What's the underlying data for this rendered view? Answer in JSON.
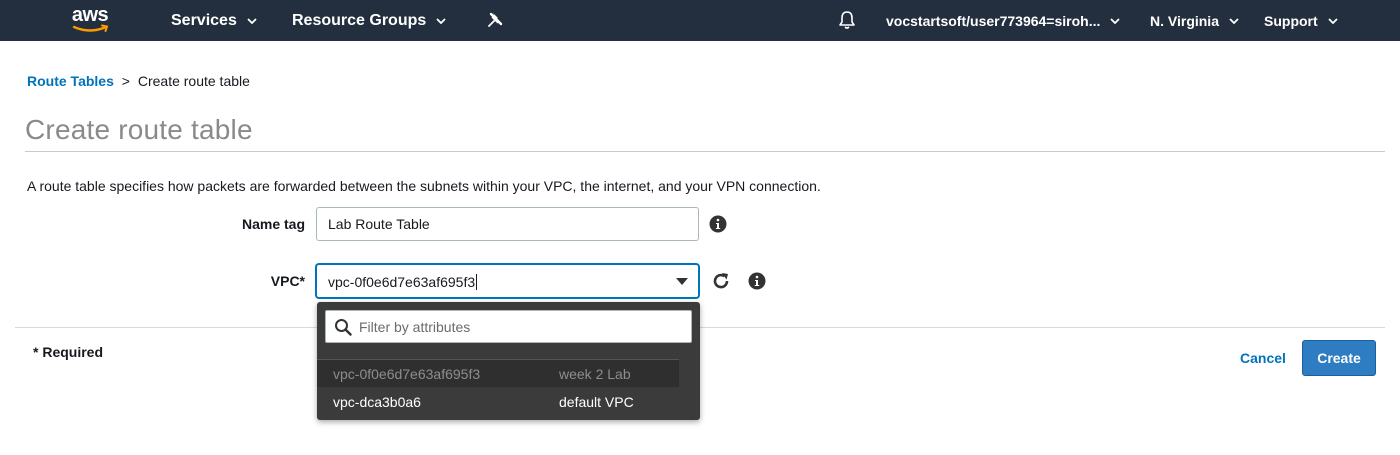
{
  "topnav": {
    "logo_text": "aws",
    "services_label": "Services",
    "resource_groups_label": "Resource Groups",
    "account_label": "vocstartsoft/user773964=siroh...",
    "region_label": "N. Virginia",
    "support_label": "Support",
    "icons": [
      "aws-logo",
      "pin-icon",
      "bell-icon",
      "chevron-down-icon"
    ],
    "bg_color": "#232f3e"
  },
  "breadcrumb": {
    "parent": "Route Tables",
    "separator": ">",
    "current": "Create route table"
  },
  "page": {
    "title": "Create route table",
    "description": "A route table specifies how packets are forwarded between the subnets within your VPC, the internet, and your VPN connection."
  },
  "form": {
    "name_tag_label": "Name tag",
    "name_tag_value": "Lab Route Table",
    "vpc_label": "VPC*",
    "vpc_value": "vpc-0f0e6d7e63af695f3",
    "required_note": "* Required"
  },
  "dropdown": {
    "filter_placeholder": "Filter by attributes",
    "options": [
      {
        "id": "vpc-0f0e6d7e63af695f3",
        "name": "week 2 Lab",
        "selected": true
      },
      {
        "id": "vpc-dca3b0a6",
        "name": "default VPC",
        "selected": false
      }
    ]
  },
  "actions": {
    "cancel_label": "Cancel",
    "create_label": "Create"
  },
  "colors": {
    "link": "#0073bb",
    "primary_button": "#2e7cc1",
    "dropdown_bg": "#3b3b3b"
  }
}
